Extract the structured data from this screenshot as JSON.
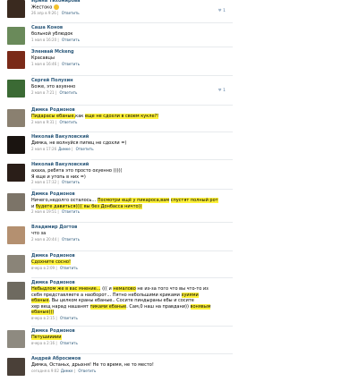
{
  "comments": [
    {
      "name": "Ирина Тихомирова",
      "lines": [
        [
          {
            "t": "Жестоко "
          }
        ]
      ],
      "emoji": true,
      "meta": "26 апр в 9:26",
      "reply": "Ответить",
      "likes": "1"
    },
    {
      "name": "Саша Конов",
      "lines": [
        [
          {
            "t": "больной ублюдок"
          }
        ]
      ],
      "meta": "1 мая в 16:20",
      "reply": "Ответить"
    },
    {
      "name": "Эленвай Мсkeng",
      "lines": [
        [
          {
            "t": "Красавцы"
          }
        ]
      ],
      "meta": "1 мая в 16:46",
      "reply": "Ответить"
    },
    {
      "name": "Сергей Полухин",
      "lines": [
        [
          {
            "t": "Боже, это ахуенно"
          }
        ]
      ],
      "meta": "2 мая в 7:21",
      "reply": "Ответить",
      "likes": "1"
    },
    {
      "name": "Димка Родионов",
      "lines": [
        [
          {
            "t": "Пидарасы ебаные,",
            "h": true
          },
          {
            "t": "как "
          },
          {
            "t": "еще не сдохли в своем кукле?!",
            "h": true
          }
        ]
      ],
      "meta": "2 мая в 9:31",
      "reply": "Ответить"
    },
    {
      "name": "Николай Вакуловский",
      "lines": [
        [
          {
            "t": "Димка, не волнуйся пипец не сдохли =)"
          }
        ]
      ],
      "meta": "2 мая в 17:26",
      "to": "Димке",
      "reply": "Ответить"
    },
    {
      "name": "Николай Вакуловский",
      "lines": [
        [
          {
            "t": "ахаха, ребята это просто охуенно ((((("
          }
        ],
        [
          {
            "t": "Я еще и утопь в них =)"
          }
        ]
      ],
      "meta": "2 мая в 17:32",
      "reply": "Ответить"
    },
    {
      "name": "Димка Родионов",
      "lines": [
        [
          {
            "t": "Ничего,недолго осталось... "
          },
          {
            "t": "Посмотри ещё у пикароса,вам",
            "h": true
          },
          {
            "t": " "
          },
          {
            "t": "спустят полный рот",
            "h": true
          }
        ],
        [
          {
            "t": "и "
          },
          {
            "t": "будете давиться(((( вы без Донбасса ничто))",
            "h": true
          }
        ]
      ],
      "meta": "2 мая в 19:51",
      "reply": "Ответить"
    },
    {
      "name": "Владимир Догтов",
      "lines": [
        [
          {
            "t": "что за"
          }
        ]
      ],
      "meta": "2 мая в 20:44",
      "reply": "Ответить"
    },
    {
      "name": "Димка Родионов",
      "lines": [
        [
          {
            "t": "Сдохните сосно!",
            "h": true
          }
        ]
      ],
      "meta": "вчера в 2:09",
      "reply": "Ответить"
    },
    {
      "name": "Димка Родионов",
      "lines": [
        [
          {
            "t": "Небыдлом же в вас мнение...",
            "h": true
          },
          {
            "t": "  ((( и "
          },
          {
            "t": "немалово",
            "h": true
          },
          {
            "t": " не из-за того что вы что-то из"
          }
        ],
        [
          {
            "t": "себя представляете а наоборот... Пятно небольшими криками "
          },
          {
            "t": "хуиями",
            "h": true
          }
        ],
        [
          {
            "t": "ебаные",
            "h": true
          },
          {
            "t": ". Вы целком краны ебаные.. Сосите пиндыраны ебы и сосите"
          }
        ],
        [
          {
            "t": "хер вещ нарад нашанят "
          },
          {
            "t": "пиками ебаные",
            "h": true
          },
          {
            "t": ". Сам,0 наш на правдани)) "
          },
          {
            "t": "вонявым",
            "h": true
          }
        ],
        [
          {
            "t": "ебаные)))",
            "h": true
          }
        ]
      ],
      "meta": "вчера в 2:15",
      "reply": "Ответить"
    },
    {
      "name": "Димка Родионов",
      "lines": [
        [
          {
            "t": "Петушиииии",
            "h": true
          }
        ]
      ],
      "meta": "вчера в 2:16",
      "reply": "Ответить"
    },
    {
      "name": "Андрей Абросимов",
      "lines": [
        [
          {
            "t": "Димка, Останьх, дрыхня! Не то время, не то место!"
          }
        ]
      ],
      "meta": "сегодня в 9:02",
      "to": "Димке",
      "reply": "Ответить"
    }
  ],
  "palette": {
    "avatars": [
      "#3a2a1f",
      "#6a8a5a",
      "#7a2a18",
      "#3b6a34",
      "#8a8070",
      "#1a1410",
      "#2a1e18",
      "#7c7468",
      "#b49070",
      "#8a8478",
      "#6e6a60",
      "#8e8a80",
      "#4a4038"
    ]
  }
}
